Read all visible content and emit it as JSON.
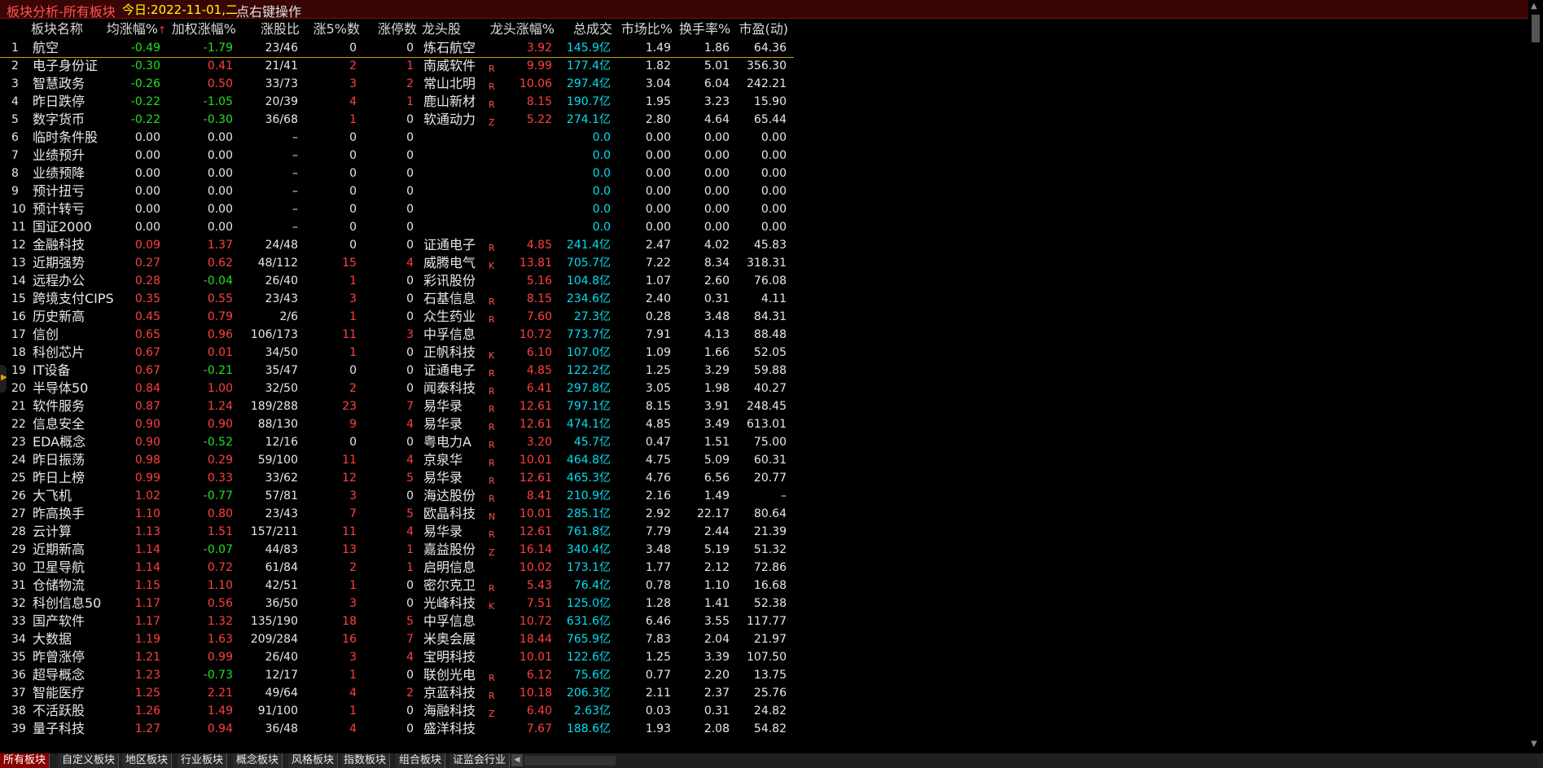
{
  "titlebar": {
    "title": "板块分析-所有板块",
    "date": "今日:2022-11-01,二",
    "hint": "点右键操作"
  },
  "columns": {
    "name": "板块名称",
    "avg": "均涨幅%",
    "sort_mark": "↑",
    "wavg": "加权涨幅%",
    "ratio": "涨股比",
    "up5": "涨5%数",
    "limit": "涨停数",
    "leader": "龙头股",
    "leader_chg": "龙头涨幅%",
    "amount": "总成交",
    "mkt": "市场比%",
    "turnover": "换手率%",
    "pe": "市盈(动)"
  },
  "rows": [
    {
      "idx": "1",
      "name": "航空",
      "avg": "-0.49",
      "wavg": "-1.79",
      "ratio": "23/46",
      "up5": "0",
      "limit": "0",
      "leader": "炼石航空",
      "code": "",
      "lchg": "3.92",
      "amount": "145.9亿",
      "mkt": "1.49",
      "turn": "1.86",
      "pe": "64.36"
    },
    {
      "idx": "2",
      "name": "电子身份证",
      "avg": "-0.30",
      "wavg": "0.41",
      "ratio": "21/41",
      "up5": "2",
      "limit": "1",
      "leader": "南威软件",
      "code": "R",
      "lchg": "9.99",
      "amount": "177.4亿",
      "mkt": "1.82",
      "turn": "5.01",
      "pe": "356.30"
    },
    {
      "idx": "3",
      "name": "智慧政务",
      "avg": "-0.26",
      "wavg": "0.50",
      "ratio": "33/73",
      "up5": "3",
      "limit": "2",
      "leader": "常山北明",
      "code": "R",
      "lchg": "10.06",
      "amount": "297.4亿",
      "mkt": "3.04",
      "turn": "6.04",
      "pe": "242.21"
    },
    {
      "idx": "4",
      "name": "昨日跌停",
      "avg": "-0.22",
      "wavg": "-1.05",
      "ratio": "20/39",
      "up5": "4",
      "limit": "1",
      "leader": "鹿山新材",
      "code": "R",
      "lchg": "8.15",
      "amount": "190.7亿",
      "mkt": "1.95",
      "turn": "3.23",
      "pe": "15.90"
    },
    {
      "idx": "5",
      "name": "数字货币",
      "avg": "-0.22",
      "wavg": "-0.30",
      "ratio": "36/68",
      "up5": "1",
      "limit": "0",
      "leader": "软通动力",
      "code": "Z",
      "lchg": "5.22",
      "amount": "274.1亿",
      "mkt": "2.80",
      "turn": "4.64",
      "pe": "65.44"
    },
    {
      "idx": "6",
      "name": "临时条件股",
      "avg": "0.00",
      "wavg": "0.00",
      "ratio": "–",
      "up5": "0",
      "limit": "0",
      "leader": "",
      "code": "",
      "lchg": "",
      "amount": "0.0",
      "mkt": "0.00",
      "turn": "0.00",
      "pe": "0.00"
    },
    {
      "idx": "7",
      "name": "业绩预升",
      "avg": "0.00",
      "wavg": "0.00",
      "ratio": "–",
      "up5": "0",
      "limit": "0",
      "leader": "",
      "code": "",
      "lchg": "",
      "amount": "0.0",
      "mkt": "0.00",
      "turn": "0.00",
      "pe": "0.00"
    },
    {
      "idx": "8",
      "name": "业绩预降",
      "avg": "0.00",
      "wavg": "0.00",
      "ratio": "–",
      "up5": "0",
      "limit": "0",
      "leader": "",
      "code": "",
      "lchg": "",
      "amount": "0.0",
      "mkt": "0.00",
      "turn": "0.00",
      "pe": "0.00"
    },
    {
      "idx": "9",
      "name": "预计扭亏",
      "avg": "0.00",
      "wavg": "0.00",
      "ratio": "–",
      "up5": "0",
      "limit": "0",
      "leader": "",
      "code": "",
      "lchg": "",
      "amount": "0.0",
      "mkt": "0.00",
      "turn": "0.00",
      "pe": "0.00"
    },
    {
      "idx": "10",
      "name": "预计转亏",
      "avg": "0.00",
      "wavg": "0.00",
      "ratio": "–",
      "up5": "0",
      "limit": "0",
      "leader": "",
      "code": "",
      "lchg": "",
      "amount": "0.0",
      "mkt": "0.00",
      "turn": "0.00",
      "pe": "0.00"
    },
    {
      "idx": "11",
      "name": "国证2000",
      "avg": "0.00",
      "wavg": "0.00",
      "ratio": "–",
      "up5": "0",
      "limit": "0",
      "leader": "",
      "code": "",
      "lchg": "",
      "amount": "0.0",
      "mkt": "0.00",
      "turn": "0.00",
      "pe": "0.00"
    },
    {
      "idx": "12",
      "name": "金融科技",
      "avg": "0.09",
      "wavg": "1.37",
      "ratio": "24/48",
      "up5": "0",
      "limit": "0",
      "leader": "证通电子",
      "code": "R",
      "lchg": "4.85",
      "amount": "241.4亿",
      "mkt": "2.47",
      "turn": "4.02",
      "pe": "45.83"
    },
    {
      "idx": "13",
      "name": "近期强势",
      "avg": "0.27",
      "wavg": "0.62",
      "ratio": "48/112",
      "up5": "15",
      "limit": "4",
      "leader": "威腾电气",
      "code": "K",
      "lchg": "13.81",
      "amount": "705.7亿",
      "mkt": "7.22",
      "turn": "8.34",
      "pe": "318.31"
    },
    {
      "idx": "14",
      "name": "远程办公",
      "avg": "0.28",
      "wavg": "-0.04",
      "ratio": "26/40",
      "up5": "1",
      "limit": "0",
      "leader": "彩讯股份",
      "code": "",
      "lchg": "5.16",
      "amount": "104.8亿",
      "mkt": "1.07",
      "turn": "2.60",
      "pe": "76.08"
    },
    {
      "idx": "15",
      "name": "跨境支付CIPS",
      "avg": "0.35",
      "wavg": "0.55",
      "ratio": "23/43",
      "up5": "3",
      "limit": "0",
      "leader": "石基信息",
      "code": "R",
      "lchg": "8.15",
      "amount": "234.6亿",
      "mkt": "2.40",
      "turn": "0.31",
      "pe": "4.11"
    },
    {
      "idx": "16",
      "name": "历史新高",
      "avg": "0.45",
      "wavg": "0.79",
      "ratio": "2/6",
      "up5": "1",
      "limit": "0",
      "leader": "众生药业",
      "code": "R",
      "lchg": "7.60",
      "amount": "27.3亿",
      "mkt": "0.28",
      "turn": "3.48",
      "pe": "84.31"
    },
    {
      "idx": "17",
      "name": "信创",
      "avg": "0.65",
      "wavg": "0.96",
      "ratio": "106/173",
      "up5": "11",
      "limit": "3",
      "leader": "中孚信息",
      "code": "",
      "lchg": "10.72",
      "amount": "773.7亿",
      "mkt": "7.91",
      "turn": "4.13",
      "pe": "88.48"
    },
    {
      "idx": "18",
      "name": "科创芯片",
      "avg": "0.67",
      "wavg": "0.01",
      "ratio": "34/50",
      "up5": "1",
      "limit": "0",
      "leader": "正帆科技",
      "code": "K",
      "lchg": "6.10",
      "amount": "107.0亿",
      "mkt": "1.09",
      "turn": "1.66",
      "pe": "52.05"
    },
    {
      "idx": "19",
      "name": "IT设备",
      "avg": "0.67",
      "wavg": "-0.21",
      "ratio": "35/47",
      "up5": "0",
      "limit": "0",
      "leader": "证通电子",
      "code": "R",
      "lchg": "4.85",
      "amount": "122.2亿",
      "mkt": "1.25",
      "turn": "3.29",
      "pe": "59.88"
    },
    {
      "idx": "20",
      "name": "半导体50",
      "avg": "0.84",
      "wavg": "1.00",
      "ratio": "32/50",
      "up5": "2",
      "limit": "0",
      "leader": "闻泰科技",
      "code": "R",
      "lchg": "6.41",
      "amount": "297.8亿",
      "mkt": "3.05",
      "turn": "1.98",
      "pe": "40.27"
    },
    {
      "idx": "21",
      "name": "软件服务",
      "avg": "0.87",
      "wavg": "1.24",
      "ratio": "189/288",
      "up5": "23",
      "limit": "7",
      "leader": "易华录",
      "code": "R",
      "lchg": "12.61",
      "amount": "797.1亿",
      "mkt": "8.15",
      "turn": "3.91",
      "pe": "248.45"
    },
    {
      "idx": "22",
      "name": "信息安全",
      "avg": "0.90",
      "wavg": "0.90",
      "ratio": "88/130",
      "up5": "9",
      "limit": "4",
      "leader": "易华录",
      "code": "R",
      "lchg": "12.61",
      "amount": "474.1亿",
      "mkt": "4.85",
      "turn": "3.49",
      "pe": "613.01"
    },
    {
      "idx": "23",
      "name": "EDA概念",
      "avg": "0.90",
      "wavg": "-0.52",
      "ratio": "12/16",
      "up5": "0",
      "limit": "0",
      "leader": "粤电力A",
      "code": "R",
      "lchg": "3.20",
      "amount": "45.7亿",
      "mkt": "0.47",
      "turn": "1.51",
      "pe": "75.00"
    },
    {
      "idx": "24",
      "name": "昨日振荡",
      "avg": "0.98",
      "wavg": "0.29",
      "ratio": "59/100",
      "up5": "11",
      "limit": "4",
      "leader": "京泉华",
      "code": "R",
      "lchg": "10.01",
      "amount": "464.8亿",
      "mkt": "4.75",
      "turn": "5.09",
      "pe": "60.31"
    },
    {
      "idx": "25",
      "name": "昨日上榜",
      "avg": "0.99",
      "wavg": "0.33",
      "ratio": "33/62",
      "up5": "12",
      "limit": "5",
      "leader": "易华录",
      "code": "R",
      "lchg": "12.61",
      "amount": "465.3亿",
      "mkt": "4.76",
      "turn": "6.56",
      "pe": "20.77"
    },
    {
      "idx": "26",
      "name": "大飞机",
      "avg": "1.02",
      "wavg": "-0.77",
      "ratio": "57/81",
      "up5": "3",
      "limit": "0",
      "leader": "海达股份",
      "code": "R",
      "lchg": "8.41",
      "amount": "210.9亿",
      "mkt": "2.16",
      "turn": "1.49",
      "pe": "–"
    },
    {
      "idx": "27",
      "name": "昨高换手",
      "avg": "1.10",
      "wavg": "0.80",
      "ratio": "23/43",
      "up5": "7",
      "limit": "5",
      "leader": "欧晶科技",
      "code": "N",
      "lchg": "10.01",
      "amount": "285.1亿",
      "mkt": "2.92",
      "turn": "22.17",
      "pe": "80.64"
    },
    {
      "idx": "28",
      "name": "云计算",
      "avg": "1.13",
      "wavg": "1.51",
      "ratio": "157/211",
      "up5": "11",
      "limit": "4",
      "leader": "易华录",
      "code": "R",
      "lchg": "12.61",
      "amount": "761.8亿",
      "mkt": "7.79",
      "turn": "2.44",
      "pe": "21.39"
    },
    {
      "idx": "29",
      "name": "近期新高",
      "avg": "1.14",
      "wavg": "-0.07",
      "ratio": "44/83",
      "up5": "13",
      "limit": "1",
      "leader": "嘉益股份",
      "code": "Z",
      "lchg": "16.14",
      "amount": "340.4亿",
      "mkt": "3.48",
      "turn": "5.19",
      "pe": "51.32"
    },
    {
      "idx": "30",
      "name": "卫星导航",
      "avg": "1.14",
      "wavg": "0.72",
      "ratio": "61/84",
      "up5": "2",
      "limit": "1",
      "leader": "启明信息",
      "code": "",
      "lchg": "10.02",
      "amount": "173.1亿",
      "mkt": "1.77",
      "turn": "2.12",
      "pe": "72.86"
    },
    {
      "idx": "31",
      "name": "仓储物流",
      "avg": "1.15",
      "wavg": "1.10",
      "ratio": "42/51",
      "up5": "1",
      "limit": "0",
      "leader": "密尔克卫",
      "code": "R",
      "lchg": "5.43",
      "amount": "76.4亿",
      "mkt": "0.78",
      "turn": "1.10",
      "pe": "16.68"
    },
    {
      "idx": "32",
      "name": "科创信息50",
      "avg": "1.17",
      "wavg": "0.56",
      "ratio": "36/50",
      "up5": "3",
      "limit": "0",
      "leader": "光峰科技",
      "code": "K",
      "lchg": "7.51",
      "amount": "125.0亿",
      "mkt": "1.28",
      "turn": "1.41",
      "pe": "52.38"
    },
    {
      "idx": "33",
      "name": "国产软件",
      "avg": "1.17",
      "wavg": "1.32",
      "ratio": "135/190",
      "up5": "18",
      "limit": "5",
      "leader": "中孚信息",
      "code": "",
      "lchg": "10.72",
      "amount": "631.6亿",
      "mkt": "6.46",
      "turn": "3.55",
      "pe": "117.77"
    },
    {
      "idx": "34",
      "name": "大数据",
      "avg": "1.19",
      "wavg": "1.63",
      "ratio": "209/284",
      "up5": "16",
      "limit": "7",
      "leader": "米奥会展",
      "code": "",
      "lchg": "18.44",
      "amount": "765.9亿",
      "mkt": "7.83",
      "turn": "2.04",
      "pe": "21.97"
    },
    {
      "idx": "35",
      "name": "昨曾涨停",
      "avg": "1.21",
      "wavg": "0.99",
      "ratio": "26/40",
      "up5": "3",
      "limit": "4",
      "leader": "宝明科技",
      "code": "",
      "lchg": "10.01",
      "amount": "122.6亿",
      "mkt": "1.25",
      "turn": "3.39",
      "pe": "107.50"
    },
    {
      "idx": "36",
      "name": "超导概念",
      "avg": "1.23",
      "wavg": "-0.73",
      "ratio": "12/17",
      "up5": "1",
      "limit": "0",
      "leader": "联创光电",
      "code": "R",
      "lchg": "6.12",
      "amount": "75.6亿",
      "mkt": "0.77",
      "turn": "2.20",
      "pe": "13.75"
    },
    {
      "idx": "37",
      "name": "智能医疗",
      "avg": "1.25",
      "wavg": "2.21",
      "ratio": "49/64",
      "up5": "4",
      "limit": "2",
      "leader": "京蓝科技",
      "code": "R",
      "lchg": "10.18",
      "amount": "206.3亿",
      "mkt": "2.11",
      "turn": "2.37",
      "pe": "25.76"
    },
    {
      "idx": "38",
      "name": "不活跃股",
      "avg": "1.26",
      "wavg": "1.49",
      "ratio": "91/100",
      "up5": "1",
      "limit": "0",
      "leader": "海融科技",
      "code": "Z",
      "lchg": "6.40",
      "amount": "2.63亿",
      "mkt": "0.03",
      "turn": "0.31",
      "pe": "24.82"
    },
    {
      "idx": "39",
      "name": "量子科技",
      "avg": "1.27",
      "wavg": "0.94",
      "ratio": "36/48",
      "up5": "4",
      "limit": "0",
      "leader": "盛洋科技",
      "code": "",
      "lchg": "7.67",
      "amount": "188.6亿",
      "mkt": "1.93",
      "turn": "2.08",
      "pe": "54.82"
    }
  ],
  "tabs": [
    "所有板块",
    "自定义板块",
    "地区板块",
    "行业板块",
    "概念板块",
    "风格板块",
    "指数板块",
    "组合板块",
    "证监会行业"
  ],
  "nav_arrow": "◀",
  "colors": {
    "up": "#ff4040",
    "down": "#20e020",
    "flat": "#e8e8e8",
    "amount": "#00e0f0",
    "title_bg": "#3a0505",
    "active_tab": "#8a0000"
  }
}
